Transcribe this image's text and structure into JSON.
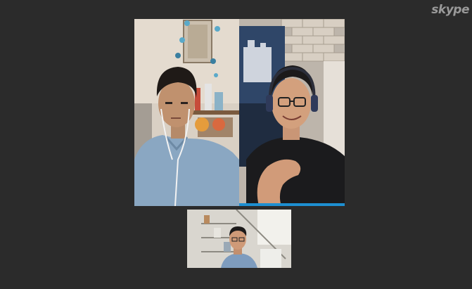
{
  "branding": {
    "watermark_text": "skype"
  },
  "colors": {
    "background": "#2b2b2b",
    "active_speaker": "#1e8fd1"
  },
  "participants": [
    {
      "role": "remote-participant-left",
      "active": false
    },
    {
      "role": "remote-participant-right",
      "active": true
    },
    {
      "role": "self-preview",
      "active": false
    }
  ],
  "icons": [
    "skype-logo"
  ]
}
